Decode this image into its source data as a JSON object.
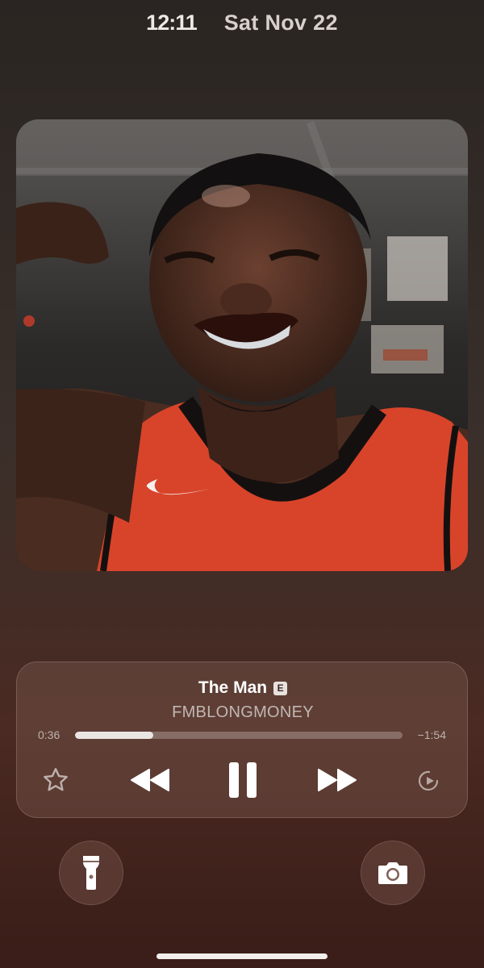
{
  "status": {
    "time": "12:11",
    "date": "Sat Nov 22"
  },
  "artwork": {
    "description_icon": "album-artwork",
    "colors": {
      "jersey": "#d8442a",
      "background": "#2d2a28"
    }
  },
  "now_playing": {
    "title": "The Man",
    "explicit_badge": "E",
    "artist": "FMBLONGMONEY",
    "elapsed": "0:36",
    "remaining": "−1:54",
    "progress_fraction": 0.24
  },
  "controls": {
    "favorite_icon": "star-icon",
    "previous_icon": "rewind-icon",
    "playpause_icon": "pause-icon",
    "next_icon": "fast-forward-icon",
    "output_icon": "airplay-icon"
  },
  "quick_actions": {
    "left_icon": "flashlight-icon",
    "right_icon": "camera-icon"
  }
}
